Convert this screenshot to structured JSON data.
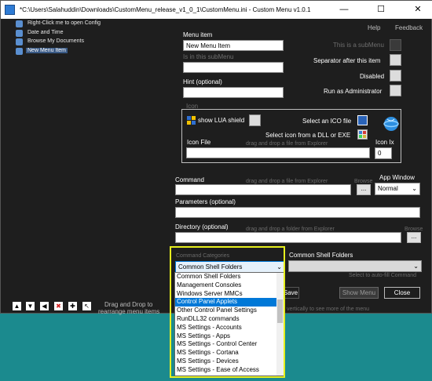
{
  "window": {
    "title": "*C:\\Users\\Salahuddin\\Downloads\\CustomMenu_release_v1_0_1\\CustomMenu.ini - Custom Menu v1.0.1",
    "minimize": "—",
    "maximize": "☐",
    "close": "✕"
  },
  "top_links": {
    "help": "Help",
    "feedback": "Feedback"
  },
  "tree": {
    "items": [
      {
        "label": "Right-Click me to open Config"
      },
      {
        "label": "Date and Time"
      },
      {
        "label": "Browse My Documents"
      },
      {
        "label": "New Menu Item"
      }
    ]
  },
  "form": {
    "menu_item_label": "Menu item",
    "menu_item_value": "New Menu Item",
    "is_in_submenu_label": "Is in this subMenu",
    "hint_label": "Hint (optional)",
    "this_is_submenu_label": "This is a subMenu",
    "separator_label": "Separator after this item",
    "disabled_label": "Disabled",
    "run_as_admin_label": "Run as Administrator",
    "icon_group_label": "Icon",
    "show_lua_label": "show LUA shield",
    "select_ico_label": "Select an ICO file",
    "select_dll_label": "Select icon from a DLL or EXE",
    "icon_file_label": "Icon File",
    "icon_file_hint": "drag and drop a file from Explorer",
    "icon_ix_label": "Icon Ix",
    "icon_ix_value": "0",
    "command_label": "Command",
    "command_hint": "drag and drop a file from Explorer",
    "browse_label": "Browse",
    "browse_btn": "...",
    "app_window_label": "App Window",
    "app_window_value": "Normal",
    "parameters_label": "Parameters (optional)",
    "directory_label": "Directory (optional)",
    "directory_hint": "drag and drop a folder from Explorer",
    "command_categories_label": "Command Categories",
    "command_categories_value": "Common Shell Folders",
    "common_shell_folders_label": "Common Shell Folders",
    "select_autofill": "Select to auto-fill Command",
    "save_label": "Save",
    "show_menu_label": "Show Menu",
    "close_label": "Close",
    "vertical_hint": "vertically to see more of the menu"
  },
  "toolbar": {
    "drag_drop_hint_line1": "Drag and Drop to",
    "drag_drop_hint_line2": "rearrange menu items",
    "buttons": [
      {
        "name": "move-top",
        "glyph": "▲"
      },
      {
        "name": "move-down",
        "glyph": "▼"
      },
      {
        "name": "move-left",
        "glyph": "◀"
      },
      {
        "name": "delete",
        "glyph": "✖"
      },
      {
        "name": "add",
        "glyph": "✚"
      },
      {
        "name": "pointer",
        "glyph": "↖"
      }
    ]
  },
  "dropdown_options": [
    "Common Shell Folders",
    "Management Consoles",
    "Windows Server MMCs",
    "Control Panel Applets",
    "Other Control Panel Settings",
    "RunDLL32 commands",
    "MS Settings - Accounts",
    "MS Settings - Apps",
    "MS Settings - Control Center",
    "MS Settings - Cortana",
    "MS Settings - Devices",
    "MS Settings - Ease of Access"
  ],
  "dropdown_selected_index": 3,
  "colors": {
    "desktop": "#1b8a8e",
    "window_bg": "#1e1e1e",
    "selection": "#0078d7",
    "highlight_border": "#e6ef1e"
  }
}
